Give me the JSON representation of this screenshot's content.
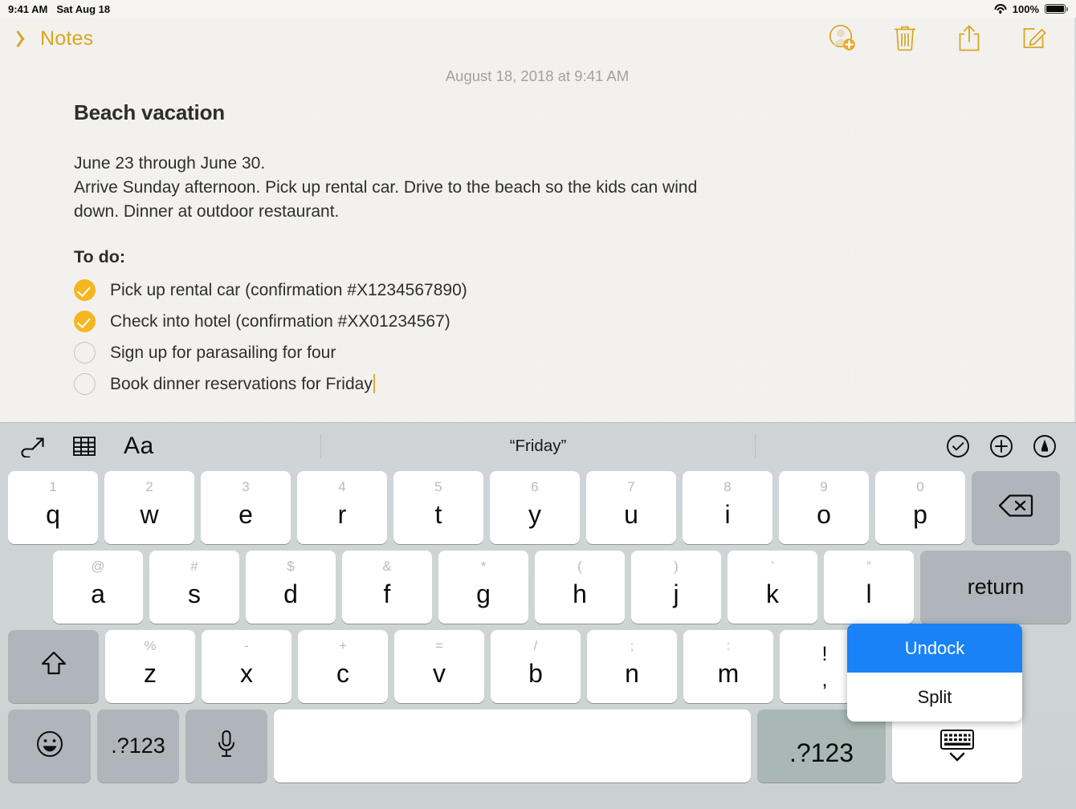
{
  "status_bar": {
    "time": "9:41 AM",
    "date": "Sat Aug 18",
    "battery_percent": "100%",
    "wifi_icon": "wifi-icon",
    "battery_icon": "battery-full-icon"
  },
  "navbar": {
    "back_label": "Notes",
    "back_icon": "chevron-left-icon",
    "accent_color": "#d9a521",
    "tools": [
      {
        "name": "add-collaborator-icon",
        "label": "Add People"
      },
      {
        "name": "trash-icon",
        "label": "Delete"
      },
      {
        "name": "share-icon",
        "label": "Share"
      },
      {
        "name": "compose-icon",
        "label": "New Note"
      }
    ]
  },
  "note": {
    "date": "August 18, 2018 at 9:41 AM",
    "title": "Beach vacation",
    "paragraph": "June 23 through June 30.\nArrive Sunday afternoon. Pick up rental car. Drive to the beach so the kids can wind down. Dinner at outdoor restaurant.",
    "paragraph_line1": "June 23 through June 30.",
    "paragraph_line2": "Arrive Sunday afternoon. Pick up rental car. Drive to the beach so the kids can wind down. Dinner at outdoor restaurant.",
    "todo_heading": "To do:",
    "checked_color": "#f5b721",
    "todos": [
      {
        "text": "Pick up rental car (confirmation #X1234567890)",
        "checked": true
      },
      {
        "text": "Check into hotel (confirmation #XX01234567)",
        "checked": true
      },
      {
        "text": "Sign up for parasailing for four",
        "checked": false
      },
      {
        "text": "Book dinner reservations for Friday",
        "checked": false,
        "cursor": true
      }
    ]
  },
  "keyboard": {
    "toolbar": {
      "undo_icon": "undo-icon",
      "table_icon": "table-icon",
      "format_label": "Aa",
      "prediction": "“Friday”",
      "checklist_icon": "checklist-circle-icon",
      "add_icon": "plus-circle-icon",
      "markup_icon": "markup-pen-icon"
    },
    "row1": [
      {
        "main": "q",
        "alt": "1"
      },
      {
        "main": "w",
        "alt": "2"
      },
      {
        "main": "e",
        "alt": "3"
      },
      {
        "main": "r",
        "alt": "4"
      },
      {
        "main": "t",
        "alt": "5"
      },
      {
        "main": "y",
        "alt": "6"
      },
      {
        "main": "u",
        "alt": "7"
      },
      {
        "main": "i",
        "alt": "8"
      },
      {
        "main": "o",
        "alt": "9"
      },
      {
        "main": "p",
        "alt": "0"
      }
    ],
    "delete_icon": "backspace-icon",
    "row2": [
      {
        "main": "a",
        "alt": "@"
      },
      {
        "main": "s",
        "alt": "#"
      },
      {
        "main": "d",
        "alt": "$"
      },
      {
        "main": "f",
        "alt": "&"
      },
      {
        "main": "g",
        "alt": "*"
      },
      {
        "main": "h",
        "alt": "("
      },
      {
        "main": "j",
        "alt": ")"
      },
      {
        "main": "k",
        "alt": "’"
      },
      {
        "main": "l",
        "alt": "”"
      }
    ],
    "return_label": "return",
    "shift_icon": "shift-arrow-icon",
    "row3": [
      {
        "main": "z",
        "alt": "%"
      },
      {
        "main": "x",
        "alt": "-"
      },
      {
        "main": "c",
        "alt": "+"
      },
      {
        "main": "v",
        "alt": "="
      },
      {
        "main": "b",
        "alt": "/"
      },
      {
        "main": "n",
        "alt": ";"
      },
      {
        "main": "m",
        "alt": ":"
      },
      {
        "main": ",",
        "alt": "!",
        "punct": true
      }
    ],
    "bottom": {
      "emoji_icon": "emoji-smiley-icon",
      "numbers_left_label": ".?123",
      "mic_icon": "microphone-icon",
      "space_label": "",
      "numbers_right_label": ".?123",
      "hide_keyboard_icon": "hide-keyboard-icon"
    }
  },
  "popup_menu": {
    "selected_color": "#1a82f7",
    "items": [
      {
        "label": "Undock",
        "selected": true
      },
      {
        "label": "Split",
        "selected": false
      }
    ]
  }
}
